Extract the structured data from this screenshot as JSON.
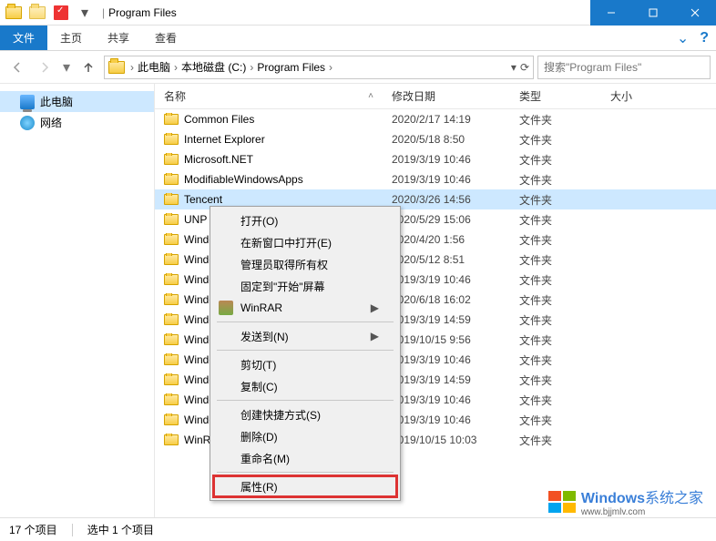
{
  "window": {
    "title": "Program Files"
  },
  "ribbon": {
    "file": "文件",
    "tabs": [
      "主页",
      "共享",
      "查看"
    ]
  },
  "breadcrumbs": [
    "此电脑",
    "本地磁盘 (C:)",
    "Program Files"
  ],
  "search": {
    "placeholder": "搜索\"Program Files\""
  },
  "sidebar": {
    "items": [
      {
        "label": "此电脑",
        "icon": "computer",
        "selected": true
      },
      {
        "label": "网络",
        "icon": "network",
        "selected": false
      }
    ]
  },
  "columns": {
    "name": "名称",
    "date": "修改日期",
    "type": "类型",
    "size": "大小"
  },
  "folder_type": "文件夹",
  "files": [
    {
      "name": "Common Files",
      "date": "2020/2/17 14:19",
      "selected": false
    },
    {
      "name": "Internet Explorer",
      "date": "2020/5/18 8:50",
      "selected": false
    },
    {
      "name": "Microsoft.NET",
      "date": "2019/3/19 10:46",
      "selected": false
    },
    {
      "name": "ModifiableWindowsApps",
      "date": "2019/3/19 10:46",
      "selected": false
    },
    {
      "name": "Tencent",
      "date": "2020/3/26 14:56",
      "selected": true
    },
    {
      "name": "UNP",
      "date": "2020/5/29 15:06",
      "selected": false
    },
    {
      "name": "Windows Defender",
      "date": "2020/4/20 1:56",
      "selected": false
    },
    {
      "name": "Windows Defender Advanced",
      "date": "2020/5/12 8:51",
      "selected": false
    },
    {
      "name": "Windows Mail",
      "date": "2019/3/19 10:46",
      "selected": false
    },
    {
      "name": "Windows Media Player",
      "date": "2020/6/18 16:02",
      "selected": false
    },
    {
      "name": "Windows Multimedia Platform",
      "date": "2019/3/19 14:59",
      "selected": false
    },
    {
      "name": "Windows NT",
      "date": "2019/10/15 9:56",
      "selected": false
    },
    {
      "name": "Windows Photo Viewer",
      "date": "2019/3/19 10:46",
      "selected": false
    },
    {
      "name": "Windows Portable Devices",
      "date": "2019/3/19 14:59",
      "selected": false
    },
    {
      "name": "Windows Security",
      "date": "2019/3/19 10:46",
      "selected": false
    },
    {
      "name": "WindowsPowerShell",
      "date": "2019/3/19 10:46",
      "selected": false
    },
    {
      "name": "WinRAR",
      "date": "2019/10/15 10:03",
      "selected": false
    }
  ],
  "context_menu": {
    "items": [
      {
        "label": "打开(O)",
        "type": "item"
      },
      {
        "label": "在新窗口中打开(E)",
        "type": "item"
      },
      {
        "label": "管理员取得所有权",
        "type": "item"
      },
      {
        "label": "固定到\"开始\"屏幕",
        "type": "item"
      },
      {
        "label": "WinRAR",
        "type": "submenu",
        "icon": "winrar"
      },
      {
        "type": "sep"
      },
      {
        "label": "发送到(N)",
        "type": "submenu"
      },
      {
        "type": "sep"
      },
      {
        "label": "剪切(T)",
        "type": "item"
      },
      {
        "label": "复制(C)",
        "type": "item"
      },
      {
        "type": "sep"
      },
      {
        "label": "创建快捷方式(S)",
        "type": "item"
      },
      {
        "label": "删除(D)",
        "type": "item"
      },
      {
        "label": "重命名(M)",
        "type": "item"
      },
      {
        "type": "sep"
      },
      {
        "label": "属性(R)",
        "type": "item",
        "highlighted": true
      }
    ]
  },
  "status": {
    "total": "17 个项目",
    "selected": "选中 1 个项目"
  },
  "watermark": {
    "brand": "Windows",
    "suffix": "系统之家",
    "url": "www.bjjmlv.com"
  }
}
